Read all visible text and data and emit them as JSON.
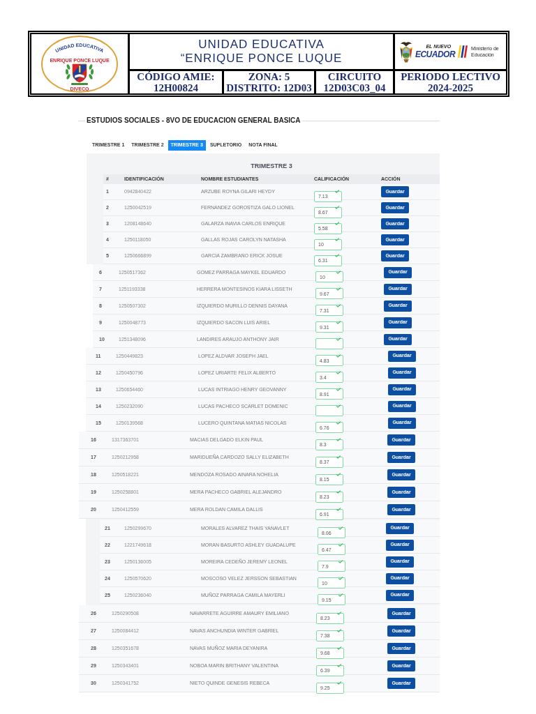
{
  "header": {
    "school_logo": {
      "top_text": "UNIDAD EDUCATIVA",
      "ring_text": "ENRIQUE PONCE LUQUE",
      "bottom_text": "DIVECO"
    },
    "school_type": "UNIDAD EDUCATIVA",
    "school_name": "“ENRIQUE PONCE LUQUE",
    "ministry_logo": {
      "tagline": "EL NUEVO",
      "country": "ECUADOR",
      "ministry": "Ministerio de Educación"
    },
    "info_cells": [
      {
        "lines": [
          "CÓDIGO AMIE:",
          "12H00824"
        ]
      },
      {
        "lines": [
          "ZONA: 5",
          "DISTRITO: 12D03"
        ]
      },
      {
        "lines": [
          "CIRCUITO",
          "12D03C03_04"
        ]
      },
      {
        "lines": [
          "PERIODO LECTIVO",
          "2024-2025"
        ]
      }
    ]
  },
  "section_title": "ESTUDIOS SOCIALES - 8VO DE EDUCACION GENERAL BASICA",
  "tabs": [
    {
      "label": "TRIMESTRE 1",
      "selected": false
    },
    {
      "label": "TRIMESTRE 2",
      "selected": false
    },
    {
      "label": "TRIMESTRE 3",
      "selected": true
    },
    {
      "label": "SUPLETORIO",
      "selected": false
    },
    {
      "label": "NOTA FINAL",
      "selected": false
    }
  ],
  "panel": {
    "title": "TRIMESTRE 3",
    "columns": [
      "#",
      "IDENTIFICACIÓN",
      "NOMBRE ESTUDIANTES",
      "CALIFICACIÓN",
      "ACCIÓN"
    ],
    "rows": [
      {
        "number": "1",
        "id": "0942840422",
        "name": "ARZUBE ROYNA GILARI HEYDY",
        "grade": "7.13",
        "valid": true,
        "action": "Guardar"
      },
      {
        "number": "2",
        "id": "1250042519",
        "name": "FERNANDEZ GOROSTIZA GALO LIONEL",
        "grade": "8.67",
        "valid": true,
        "action": "Guardar"
      },
      {
        "number": "3",
        "id": "1208148640",
        "name": "GALARZA INAVIA CARLOS ENRIQUE",
        "grade": "5.58",
        "valid": true,
        "action": "Guardar"
      },
      {
        "number": "4",
        "id": "1250118050",
        "name": "GALLAS ROJAS CAROLYN NATASHA",
        "grade": "10",
        "valid": true,
        "action": "Guardar"
      },
      {
        "number": "5",
        "id": "1250666899",
        "name": "GARCIA ZAMBRANO ERICK JOSUE",
        "grade": "6.31",
        "valid": true,
        "action": "Guardar"
      },
      {
        "number": "6",
        "id": "1250517362",
        "name": "GOMEZ PARRAGA MAYKEL EDUARDO",
        "grade": "10",
        "valid": true,
        "action": "Guardar"
      },
      {
        "number": "7",
        "id": "1251193338",
        "name": "HERRERA MONTESINOS KIARA LISSETH",
        "grade": "9.67",
        "valid": true,
        "action": "Guardar"
      },
      {
        "number": "8",
        "id": "1250507302",
        "name": "IZQUIERDO MURILLO DENNIS DAYANA",
        "grade": "7.31",
        "valid": true,
        "action": "Guardar"
      },
      {
        "number": "9",
        "id": "1250048773",
        "name": "IZQUIERDO SACON LUIS ARIEL",
        "grade": "9.31",
        "valid": true,
        "action": "Guardar"
      },
      {
        "number": "10",
        "id": "1251348096",
        "name": "LANDIRES ARAUJO ANTHONY JAIR",
        "valid": true,
        "action": "Guardar"
      },
      {
        "number": "11",
        "id": "1250449823",
        "name": "LOPEZ ALDVAR JOSEPH JAEL",
        "grade": "4.83",
        "valid": true,
        "action": "Guardar"
      },
      {
        "number": "12",
        "id": "1250450796",
        "name": "LOPEZ URIARTE FELIX ALBERTO",
        "grade": "3.4",
        "valid": true,
        "action": "Guardar"
      },
      {
        "number": "13",
        "id": "1250654460",
        "name": "LUCAS INTRIAGO HENRY GEOVANNY",
        "grade": "8.91",
        "valid": true,
        "action": "Guardar"
      },
      {
        "number": "14",
        "id": "1250232090",
        "name": "LUCAS PACHECO SCARLET DOMENIC",
        "valid": true,
        "action": "Guardar"
      },
      {
        "number": "15",
        "id": "1250139568",
        "name": "LUCERO QUINTANA MATIAS NICOLAS",
        "grade": "6.76",
        "valid": true,
        "action": "Guardar"
      },
      {
        "number": "16",
        "id": "1317363701",
        "name": "MACIAS DELGADO ELKIN PAUL",
        "grade": "8.3",
        "valid": true,
        "action": "Guardar"
      },
      {
        "number": "17",
        "id": "1250212958",
        "name": "MARIDUEÑA CARDOZO SALLY ELIZABETH",
        "grade": "8.37",
        "valid": true,
        "action": "Guardar"
      },
      {
        "number": "18",
        "id": "1250518221",
        "name": "MENDOZA ROSADO AINARA NOHELIA",
        "grade": "8.15",
        "valid": true,
        "action": "Guardar"
      },
      {
        "number": "19",
        "id": "1250258801",
        "name": "MERA PACHECO GABRIEL ALEJANDRO",
        "grade": "8.23",
        "valid": true,
        "action": "Guardar"
      },
      {
        "number": "20",
        "id": "1250412559",
        "name": "MERA ROLDAN CAMILA DALLIS",
        "grade": "6.91",
        "valid": true,
        "action": "Guardar"
      },
      {
        "number": "21",
        "id": "1250299670",
        "name": "MORALES ALVAREZ THAIS YANAVLET",
        "grade": "8.06",
        "valid": true,
        "action": "Guardar"
      },
      {
        "number": "22",
        "id": "1221749618",
        "name": "MORAN BASURTO ASHLEY GUADALUPE",
        "grade": "6.47",
        "valid": true,
        "action": "Guardar"
      },
      {
        "number": "23",
        "id": "1250136005",
        "name": "MOREIRA CEDEÑO JEREMY LEONEL",
        "grade": "7.9",
        "valid": true,
        "action": "Guardar"
      },
      {
        "number": "24",
        "id": "1250570620",
        "name": "MOSCOSO VELEZ JERSSON SEBASTIAN",
        "grade": "10",
        "valid": true,
        "action": "Guardar"
      },
      {
        "number": "25",
        "id": "1250236040",
        "name": "MUÑOZ PARRAGA CAMILA MAYERLI",
        "grade": "9.15",
        "valid": true,
        "action": "Guardar"
      },
      {
        "number": "26",
        "id": "1250290508",
        "name": "NAVARRETE AGUIRRE AMAURY EMILIANO",
        "grade": "8.23",
        "valid": true,
        "action": "Guardar"
      },
      {
        "number": "27",
        "id": "1250084412",
        "name": "NAVAS ANCHUNDIA WINTER GABRIEL",
        "grade": "7.38",
        "valid": true,
        "action": "Guardar"
      },
      {
        "number": "28",
        "id": "1250351678",
        "name": "NAVAS MUÑOZ MARIA DEYANIRA",
        "grade": "9.68",
        "valid": true,
        "action": "Guardar"
      },
      {
        "number": "29",
        "id": "1250343401",
        "name": "NOBOA MARIN BRITHANY VALENTINA",
        "grade": "6.39",
        "valid": true,
        "action": "Guardar"
      },
      {
        "number": "30",
        "id": "1250341752",
        "name": "NIETO QUINDE GENESIS REBECA",
        "grade": "9.25",
        "valid": true,
        "action": "Guardar"
      }
    ]
  }
}
